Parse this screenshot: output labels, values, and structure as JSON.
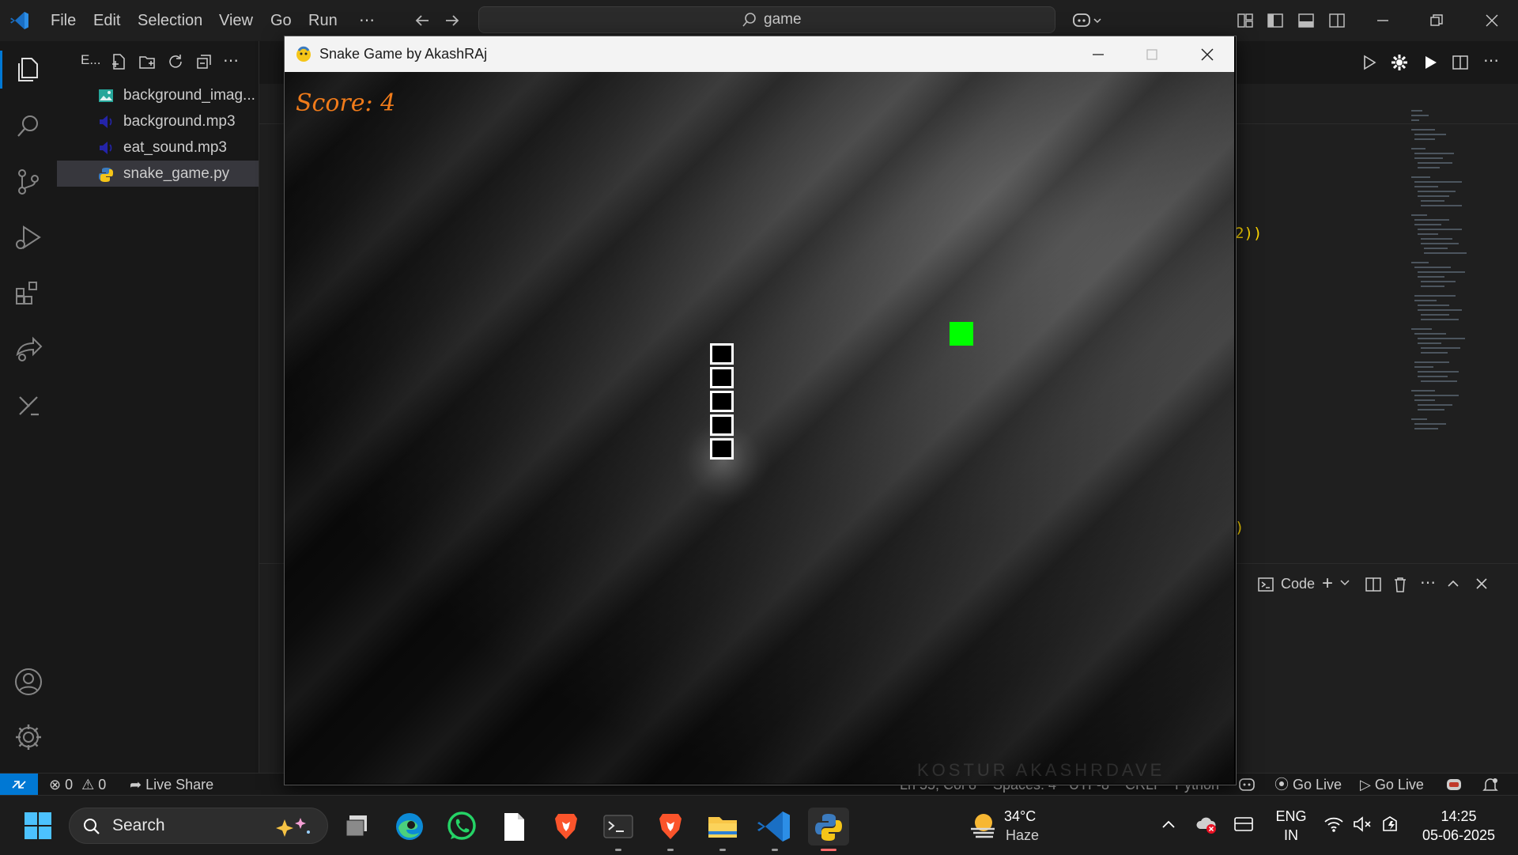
{
  "vscode": {
    "menu": [
      "File",
      "Edit",
      "Selection",
      "View",
      "Go",
      "Run"
    ],
    "command_center": "game",
    "explorer_label": "E...",
    "files": [
      {
        "name": "background_imag...",
        "icon": "image-icon"
      },
      {
        "name": "background.mp3",
        "icon": "audio-icon"
      },
      {
        "name": "eat_sound.mp3",
        "icon": "audio-icon"
      },
      {
        "name": "snake_game.py",
        "icon": "python-icon"
      }
    ],
    "editor_fragments": [
      "2))",
      ")"
    ],
    "panel": {
      "terminal_label": "Code"
    }
  },
  "status": {
    "errors": "0",
    "warnings": "0",
    "live_share": "Live Share",
    "position": "Ln 55, Col 8",
    "spaces": "Spaces: 4",
    "encoding": "UTF-8",
    "eol": "CRLF",
    "language": "Python",
    "go_live_1": "Go Live",
    "go_live_2": "Go Live"
  },
  "game_window": {
    "title": "Snake Game by AkashRAj",
    "score_text": "Score: 4",
    "watermark": "KOSTUR  AKASHRDAVE"
  },
  "taskbar": {
    "search_placeholder": "Search",
    "weather_temp": "34°C",
    "weather_desc": "Haze",
    "lang_1": "ENG",
    "lang_2": "IN",
    "time": "14:25",
    "date": "05-06-2025"
  },
  "colors": {
    "vscode_blue": "#0078d4",
    "score_orange": "#f07b1a",
    "food_green": "#00ff00"
  }
}
